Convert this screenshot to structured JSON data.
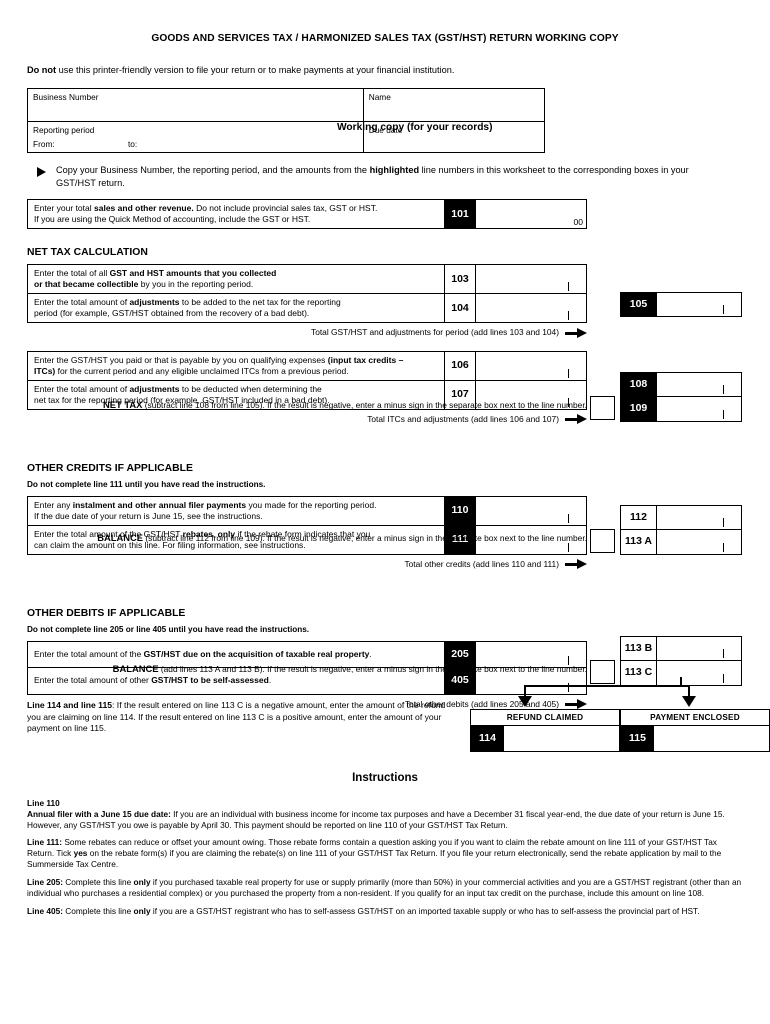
{
  "document": {
    "title": "GOODS AND SERVICES TAX / HARMONIZED SALES TAX (GST/HST) RETURN WORKING COPY",
    "donot_bold": "Do not",
    "donot_rest": " use this printer-friendly version to file your return or to make payments at your financial institution."
  },
  "identification": {
    "business_number_label": "Business Number",
    "business_number_value": "",
    "name_label": "Name",
    "name_value": "",
    "reporting_period_label": "Reporting period",
    "from_label": "From:",
    "from_value": "",
    "to_label": "to:",
    "to_value": "",
    "due_date_label": "Due date",
    "due_date_value": "",
    "working_copy_label": "Working copy (for your records)"
  },
  "note": {
    "part1": "Copy your Business Number, the reporting period, and the amounts from the ",
    "highlighted": "highlighted",
    "part2": " line numbers in this worksheet to the corresponding boxes in your GST/HST return."
  },
  "line101": {
    "desc_a1": "Enter your total ",
    "desc_b1": "sales and other revenue.",
    "desc_a2": " Do not include provincial sales tax, GST or HST.",
    "desc_a3": "If you are using the Quick Method of accounting, include the GST or HST.",
    "number": "101",
    "value": "",
    "cents": "00"
  },
  "net_tax_calculation": {
    "heading": "NET TAX CALCULATION",
    "rows": [
      {
        "pre": "Enter the total of all ",
        "bold": "GST and HST amounts that you collected",
        "bold2": "or that became collectible",
        "post": " by you in the reporting period.",
        "number": "103",
        "value": ""
      },
      {
        "pre": "Enter the total amount of ",
        "bold": "adjustments",
        "post": " to be added to the net tax for the reporting",
        "post2": "period (for example, GST/HST obtained from the recovery of a bad debt).",
        "number": "104",
        "value": ""
      }
    ],
    "total_label": "Total GST/HST and adjustments for period (add lines 103 and 104)",
    "total_number": "105",
    "total_value": ""
  },
  "itc_section": {
    "rows": [
      {
        "pre": "Enter the GST/HST you paid or that is payable by you on qualifying expenses ",
        "bold": "(input tax credits –",
        "bold2": "ITCs)",
        "post": " for the current period and any eligible unclaimed ITCs from a previous period.",
        "number": "106",
        "value": ""
      },
      {
        "pre": "Enter the total amount of ",
        "bold": "adjustments",
        "post": " to be deducted when determining the",
        "post2": "net tax for the reporting period (for example, GST/HST included in a bad debt).",
        "number": "107",
        "value": ""
      }
    ],
    "total_label": "Total ITCs and adjustments (add lines 106 and 107)",
    "total_number": "108",
    "total_value": "",
    "net_tax_bold": "NET TAX",
    "net_tax_rest": " (subtract line 108 from line 105). If the result is negative, enter a minus sign in the separate box next to the line number.",
    "net_tax_number": "109",
    "net_tax_value": "",
    "net_tax_sign": ""
  },
  "other_credits": {
    "heading": "OTHER CREDITS IF APPLICABLE",
    "subheading": "Do not complete line 111 until you have read the instructions.",
    "rows": [
      {
        "pre": "Enter any ",
        "bold": "instalment and other annual filer payments",
        "post": " you made for the reporting period.",
        "post2": "If the due date of your return is June 15, see the instructions.",
        "number": "110",
        "value": ""
      },
      {
        "pre": "Enter the total amount of the GST/HST ",
        "bold": "rebates",
        "bold_mid": ", ",
        "bold2": "only",
        "post": " if the rebate form indicates that you",
        "post2": "can claim the amount on this line. For filing information, see instructions.",
        "number": "111",
        "value": ""
      }
    ],
    "total_label": "Total other credits (add lines 110 and 111)",
    "total_number": "112",
    "total_value": "",
    "balance_bold": "BALANCE",
    "balance_rest": " (subtract line 112 from line 109). If the result is negative, enter a minus sign in the separate box next to the line number.",
    "balance_number": "113 A",
    "balance_value": "",
    "balance_sign": ""
  },
  "other_debits": {
    "heading": "OTHER DEBITS IF APPLICABLE",
    "subheading": "Do not complete line 205 or line 405 until you have read the instructions.",
    "rows": [
      {
        "pre": "Enter the total amount of the ",
        "bold": "GST/HST due on the acquisition of taxable real property",
        "post": ".",
        "number": "205",
        "value": ""
      },
      {
        "pre": "Enter the total amount of other ",
        "bold": "GST/HST to be self-assessed",
        "post": ".",
        "number": "405",
        "value": ""
      }
    ],
    "total_label": "Total other debits (add lines 205 and 405)",
    "total_number": "113 B",
    "total_value": "",
    "balance_bold": "BALANCE",
    "balance_rest": " (add lines 113 A and 113 B). If the result is negative, enter a minus sign in the separate box next to the line number.",
    "balance_number": "113 C",
    "balance_value": "",
    "balance_sign": ""
  },
  "refund_payment": {
    "line114_bold": "Line 114 and line 115",
    "line114_rest": ": If the result entered on line 113 C is a negative amount, enter the amount of the refund you are claiming on line 114. If the result entered on line 113 C is a positive amount, enter the amount of your payment on line 115.",
    "refund_header": "REFUND CLAIMED",
    "refund_number": "114",
    "refund_value": "",
    "payment_header": "PAYMENT ENCLOSED",
    "payment_number": "115",
    "payment_value": ""
  },
  "instructions": {
    "title": "Instructions",
    "line110_head": "Line 110",
    "line110_bold": "Annual filer with a June 15 due date:",
    "line110_rest": " If you are an individual with business income for income tax purposes and have a December 31 fiscal year-end, the due date of your return is June 15. However, any GST/HST you owe is payable by April 30. This payment should be reported on line 110 of your GST/HST Tax Return.",
    "line111_bold": "Line 111:",
    "line111_a": " Some rebates can reduce or offset your amount owing. Those rebate forms contain a question asking you if you want to claim the rebate amount on line 111 of your GST/HST Tax Return. Tick ",
    "line111_yes": "yes",
    "line111_b": " on the rebate form(s) if you are claiming the rebate(s) on line 111 of your GST/HST Tax Return. If you file your return electronically, send the rebate application by mail to the Summerside Tax Centre.",
    "line205_bold": "Line 205:",
    "line205_a": " Complete this line ",
    "line205_only": "only",
    "line205_b": " if you purchased taxable real property for use or supply primarily (more than 50%) in your commercial activities and you are a GST/HST registrant (other than an individual who purchases a residential complex) or you purchased the property from a non-resident. If you qualify for an input tax credit on the purchase, include this amount on line 108.",
    "line405_bold": "Line 405:",
    "line405_a": " Complete this line ",
    "line405_only": "only",
    "line405_b": " if you are a GST/HST registrant who has to self-assess GST/HST on an imported taxable supply or who has to self-assess the provincial part of HST."
  }
}
